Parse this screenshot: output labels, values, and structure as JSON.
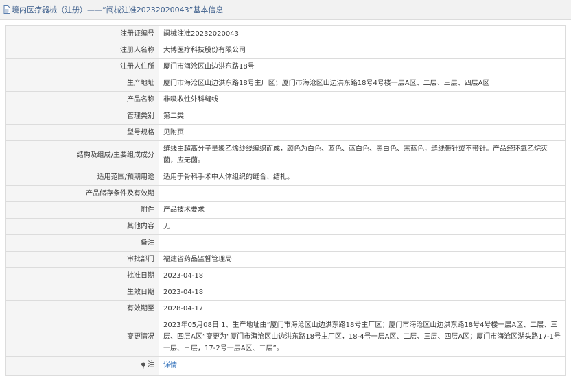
{
  "header": {
    "icon": "document-icon",
    "title": "境内医疗器械（注册）——“闽械注准20232020043”基本信息"
  },
  "rows": [
    {
      "label": "注册证编号",
      "value": "闽械注准20232020043"
    },
    {
      "label": "注册人名称",
      "value": "大博医疗科技股份有限公司"
    },
    {
      "label": "注册人住所",
      "value": "厦门市海沧区山边洪东路18号"
    },
    {
      "label": "生产地址",
      "value": "厦门市海沧区山边洪东路18号主厂区；厦门市海沧区山边洪东路18号4号楼一层A区、二层、三层、四层A区"
    },
    {
      "label": "产品名称",
      "value": "非吸收性外科缝线"
    },
    {
      "label": "管理类别",
      "value": "第二类"
    },
    {
      "label": "型号规格",
      "value": "见附页"
    },
    {
      "label": "结构及组成/主要组成成分",
      "value": "缝线由超高分子量聚乙烯纱线编织而成，颜色为白色、蓝色、蓝白色、黑白色、黑蓝色，缝线带针或不带针。产品经环氧乙烷灭菌，应无菌。"
    },
    {
      "label": "适用范围/预期用途",
      "value": "适用于骨科手术中人体组织的缝合、结扎。"
    },
    {
      "label": "产品储存条件及有效期",
      "value": ""
    },
    {
      "label": "附件",
      "value": "产品技术要求"
    },
    {
      "label": "其他内容",
      "value": "无"
    },
    {
      "label": "备注",
      "value": ""
    },
    {
      "label": "审批部门",
      "value": "福建省药品监督管理局"
    },
    {
      "label": "批准日期",
      "value": "2023-04-18"
    },
    {
      "label": "生效日期",
      "value": "2023-04-18"
    },
    {
      "label": "有效期至",
      "value": "2028-04-17"
    },
    {
      "label": "变更情况",
      "value": "2023年05月08日 1、生产地址由“厦门市海沧区山边洪东路18号主厂区；厦门市海沧区山边洪东路18号4号楼一层A区、二层、三层、四层A区”变更为“厦门市海沧区山边洪东路18号主厂区，18-4号一层A区、二层、三层、四层A区；厦门市海沧区湖头路17-1号一层、三层，17-2号一层A区、二层”。"
    }
  ],
  "note": {
    "icon": "pin-icon",
    "label": "注",
    "link": "详情"
  },
  "theme": {
    "title-text": "#3d5f8c",
    "title-bg": "#f2f2f2",
    "label-bg": "#f5f5f5",
    "border": "#dcdcdc",
    "text": "#3a3a3a",
    "link": "#2f6fba"
  }
}
